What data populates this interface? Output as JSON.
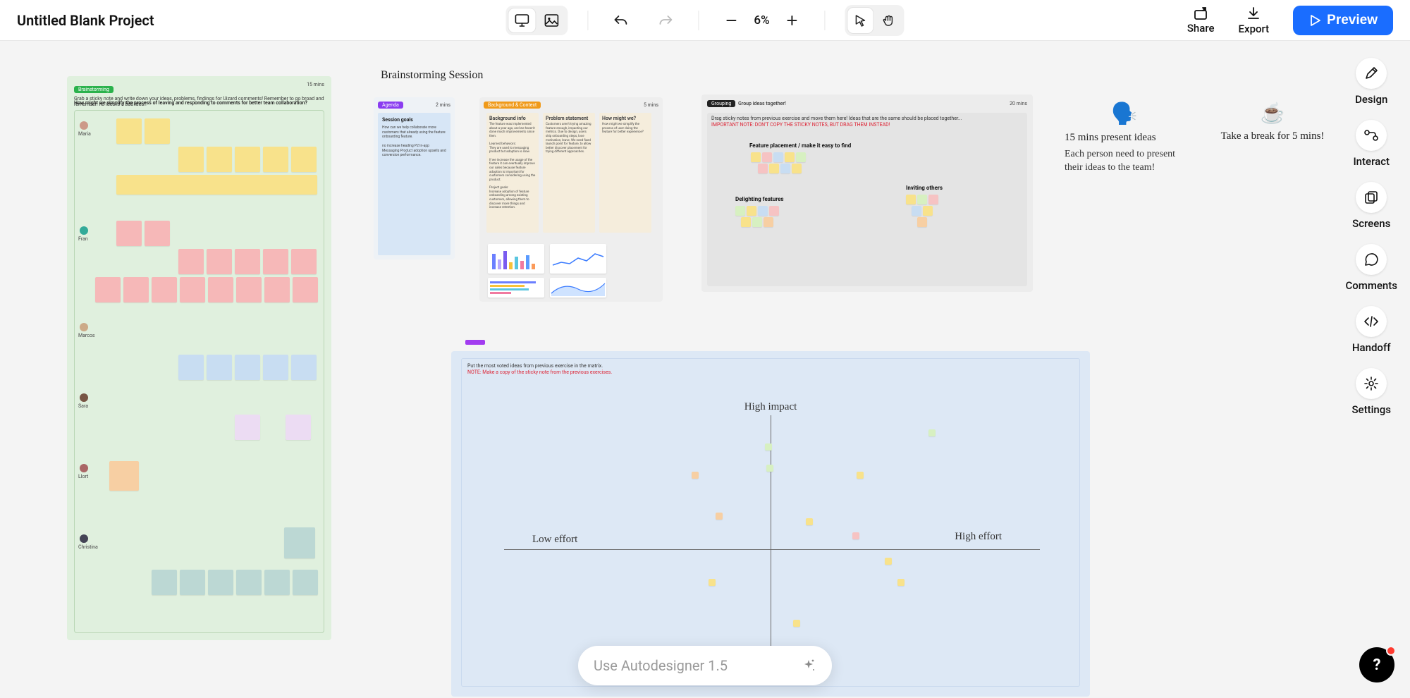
{
  "header": {
    "title": "Untitled Blank Project",
    "zoom": "6%",
    "share": "Share",
    "export": "Export",
    "preview": "Preview"
  },
  "rail": {
    "design": "Design",
    "interact": "Interact",
    "screens": "Screens",
    "comments": "Comments",
    "handoff": "Handoff",
    "settings": "Settings"
  },
  "canvas": {
    "session_title": "Brainstorming Session",
    "brainstorm_board": {
      "tag": "Brainstorming",
      "time": "15 mins",
      "prompt": "Grab a sticky note and write down your ideas, problems, findings for Uizard comments! Remember to go broad and remember: no idea is a bad idea!!",
      "question": "How might we simplify the process of leaving and responding to comments for better team collaboration?",
      "participants": [
        "Maria",
        "Fran",
        "Marcos",
        "Sara",
        "Llort",
        "Christina"
      ]
    },
    "agenda_board": {
      "tag": "Agenda",
      "time": "2 mins",
      "title": "Session goals",
      "body": "How can we help collaborate more customers that already using the feature onboarding feature.\n\nno increase heading P2 In-app\nMessaging Product adoption upsells and conversion performance."
    },
    "context_board": {
      "tag": "Background & Context",
      "time": "5 mins",
      "cols": {
        "c1_title": "Background info",
        "c1_body": "The feature was implemented about a year ago, and we haven't done much improvements since then.\n\nLearned behaviors:\nThey are used to messaging product but adoption is slow.\n\nIf we increase the usage of the feature it can eventually improve our sales because feature adoption is important for customers considering using the product.\n\nProject goals:\nIncrease adoption of feature onboarding among existing customers, allowing them to discover more things and increase retention.",
        "c2_title": "Problem statement",
        "c2_body": "Customers aren't trying amazing feature enough, impacting our metrics. Due to design, users skip onboarding steps, lose motivation, leave. We need fixed launch point for feature, to allow better discover placement for trying different approaches.",
        "c3_title": "How might we?",
        "c3_body": "How might we simplify the process of user doing the feature for better experience?"
      }
    },
    "grouping_board": {
      "tag": "Grouping",
      "heading": "Group ideas together!",
      "time": "20 mins",
      "instr": "Drag sticky notes from previous exercise and move them here! Ideas that are the same should be placed together...",
      "warn": "IMPORTANT NOTE: DON'T COPY THE STICKY NOTES, BUT DRAG THEM INSTEAD!",
      "g1": "Feature placement / make it easy to find",
      "g2": "Delighting features",
      "g3": "Inviting others"
    },
    "notes": {
      "present": "15 mins present ideas",
      "present_body": "Each person need to present their ideas to the team!",
      "break": "Take a break for 5 mins!"
    },
    "matrix": {
      "instr": "Put the most voted ideas from previous exercise in the matrix.",
      "warn": "NOTE: Make a copy of the sticky note from the previous exercises.",
      "y_top": "High impact",
      "x_left": "Low effort",
      "x_right": "High effort"
    }
  },
  "autodesigner": {
    "placeholder": "Use Autodesigner 1.5"
  }
}
